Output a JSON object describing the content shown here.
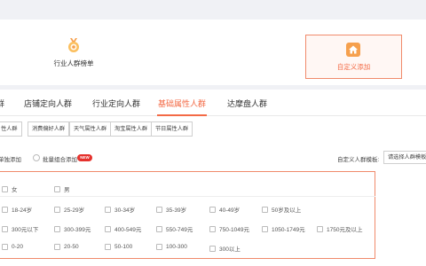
{
  "cards": [
    {
      "label": "行业人群榜单",
      "icon": "medal-icon"
    },
    {
      "label": "自定义添加",
      "icon": "house-icon"
    }
  ],
  "tabs": {
    "partial_left": "群",
    "items": [
      "店铺定向人群",
      "行业定向人群",
      "基础属性人群",
      "达摩盘人群"
    ],
    "active_index": 2
  },
  "subtabs": [
    "性人群",
    "消费偏好人群",
    "天气属性人群",
    "淘宝属性人群",
    "节日属性人群"
  ],
  "mode": {
    "single_label": "单独添加",
    "batch_label": "批量组合添加",
    "new_badge": "NEW"
  },
  "template": {
    "label": "自定义人群模板:",
    "select_value": "请选择人群模板"
  },
  "options": {
    "gender": [
      "女",
      "男"
    ],
    "age": [
      "18-24岁",
      "25-29岁",
      "30-34岁",
      "35-39岁",
      "40-49岁",
      "50岁及以上"
    ],
    "spending": [
      "300元以下",
      "300-399元",
      "400-549元",
      "550-749元",
      "750-1049元",
      "1050-1749元",
      "1750元及以上"
    ],
    "misc": [
      "0-20",
      "20-50",
      "50-100",
      "100-300",
      "300以上"
    ]
  },
  "colors": {
    "accent": "#f36a45",
    "badge": "#e5322d",
    "border": "#f08a6b"
  }
}
